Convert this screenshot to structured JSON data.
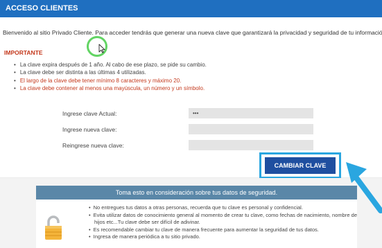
{
  "header": {
    "title": "ACCESO CLIENTES"
  },
  "welcome": {
    "text": "Bienvenido al sitio Privado Cliente. Para acceder tendrás que generar una nueva clave que garantizará la privacidad y seguridad de tu información."
  },
  "important": {
    "title": "IMPORTANTE",
    "rules": [
      "La clave expira después de 1 año. Al cabo de ese plazo, se pide su cambio.",
      "La clave debe ser distinta a las últimas 4 utilizadas.",
      "El largo de la clave debe tener mínimo 8 caracteres y máximo 20.",
      "La clave debe contener al menos una mayúscula, un número y un símbolo."
    ]
  },
  "form": {
    "current_label": "Ingrese clave Actual:",
    "current_value": "•••",
    "new_label": "Ingrese nueva clave:",
    "new_value": "",
    "repeat_label": "Reingrese nueva clave:",
    "repeat_value": "",
    "submit_label": "CAMBIAR CLAVE"
  },
  "security": {
    "title": "Toma esto en consideración sobre tus datos de seguridad.",
    "tips": [
      "No entregues tus datos a otras personas, recuerda que tu clave es personal y confidencial.",
      "Evita utilizar datos de conocimiento general al momento de crear tu clave, como fechas de nacimiento, nombre de hijos etc...Tu clave debe ser difícil de adivinar.",
      "Es recomendable cambiar tu clave de manera frecuente para aumentar la seguridad de tus datos.",
      "Ingresa de manera periódica a tu sitio privado."
    ]
  },
  "colors": {
    "header_bg": "#1f6fc0",
    "button_bg": "#1f4fa0",
    "highlight": "#2aa6e0",
    "warning_red": "#c4391d",
    "security_header": "#5a87a8",
    "cursor_ring": "#62d463"
  }
}
